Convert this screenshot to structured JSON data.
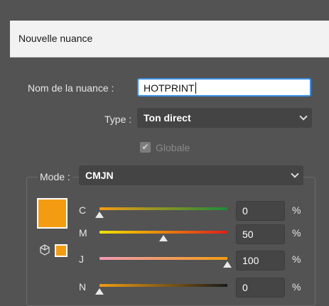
{
  "dialog": {
    "title": "Nouvelle nuance"
  },
  "form": {
    "name_label": "Nom de la nuance :",
    "name_value": "HOTPRINT",
    "type_label": "Type :",
    "type_value": "Ton direct",
    "global_label": "Globale",
    "global_checked": true,
    "mode_label": "Mode :",
    "mode_value": "CMJN"
  },
  "swatch_color": "#f39c12",
  "channels": [
    {
      "label": "C",
      "value": "0",
      "unit": "%",
      "gradient_start": "#f39c12",
      "gradient_end": "#1f8a3a",
      "level": 0
    },
    {
      "label": "M",
      "value": "50",
      "unit": "%",
      "gradient_start": "#f1e400",
      "gradient_end": "#e0201a",
      "level": 0.5
    },
    {
      "label": "J",
      "value": "100",
      "unit": "%",
      "gradient_start": "#f29bb5",
      "gradient_end": "#f39c12",
      "level": 1
    },
    {
      "label": "N",
      "value": "0",
      "unit": "%",
      "gradient_start": "#f39c12",
      "gradient_end": "#1a1a1a",
      "level": 0
    }
  ]
}
